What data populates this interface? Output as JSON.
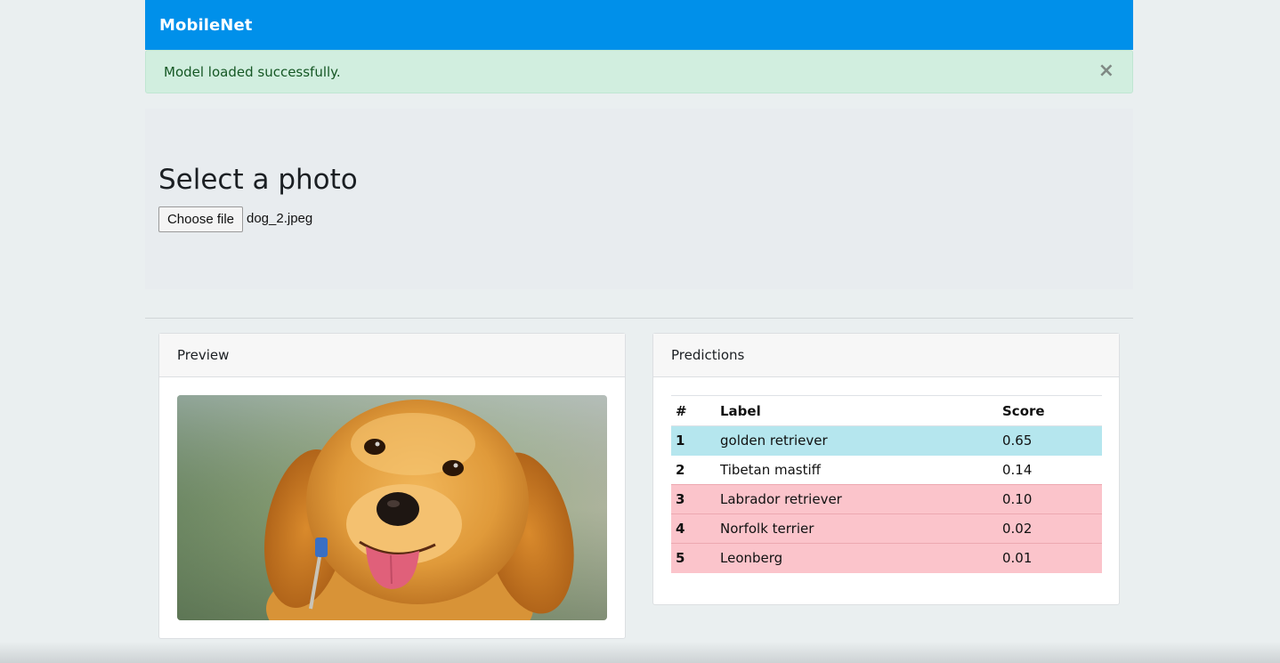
{
  "navbar": {
    "brand": "MobileNet"
  },
  "alert": {
    "message": "Model loaded successfully.",
    "close_symbol": "×"
  },
  "upload": {
    "heading": "Select a photo",
    "button_label": "Choose file",
    "file_name": "dog_2.jpeg"
  },
  "preview": {
    "title": "Preview",
    "image_subject": "golden retriever puppy"
  },
  "predictions": {
    "title": "Predictions",
    "columns": [
      "#",
      "Label",
      "Score"
    ],
    "rows": [
      {
        "rank": "1",
        "label": "golden retriever",
        "score": "0.65",
        "style": "info"
      },
      {
        "rank": "2",
        "label": "Tibetan mastiff",
        "score": "0.14",
        "style": "plain"
      },
      {
        "rank": "3",
        "label": "Labrador retriever",
        "score": "0.10",
        "style": "danger"
      },
      {
        "rank": "4",
        "label": "Norfolk terrier",
        "score": "0.02",
        "style": "danger"
      },
      {
        "rank": "5",
        "label": "Leonberg",
        "score": "0.01",
        "style": "danger"
      }
    ]
  },
  "colors": {
    "navbar": "#0090ea",
    "alert_bg": "#d1eedf",
    "row_info": "#b5e6ee",
    "row_danger": "#fbc4cb"
  }
}
